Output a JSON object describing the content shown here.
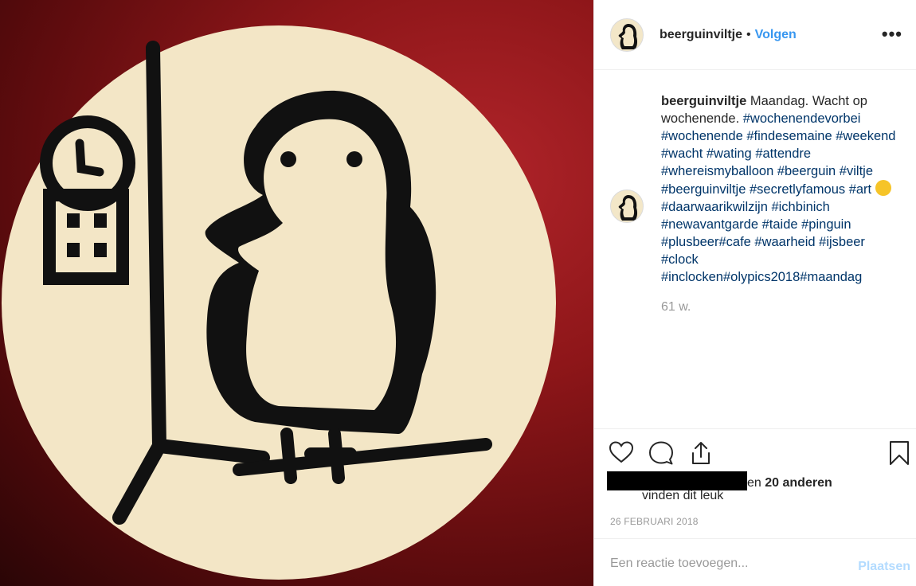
{
  "post": {
    "username": "beerguinviltje",
    "separator": "•",
    "follow_label": "Volgen",
    "more_label": "•••"
  },
  "caption": {
    "username": "beerguinviltje",
    "text": " Maandag. Wacht op wochenende. ",
    "tags_part1": "#wochenendevorbei #wochenende #findesemaine #weekend #wacht #wating #attendre #whereismyballoon #beerguin #viltje #beerguinviltje #secretlyfamous #art",
    "emoji_name": "artist-palette-emoji",
    "tags_part2": " #daarwaarikwilzijn #ichbinich #newavantgarde #taide #pinguin #plusbeer#cafe #waarheid #ijsbeer #clock #inclocken#olypics2018#maandag",
    "time_ago": "61 w."
  },
  "likes": {
    "suffix": "en ",
    "count_text": "20 anderen",
    "second_line": "vinden dit leuk"
  },
  "date": "26 FEBRUARI 2018",
  "comment": {
    "placeholder": "Een reactie toevoegen...",
    "post_label": "Plaatsen"
  },
  "icons": [
    "heart-icon",
    "comment-icon",
    "share-icon",
    "bookmark-icon",
    "more-icon"
  ],
  "colors": {
    "link": "#3897f0",
    "hashtag": "#003569",
    "muted": "#999999",
    "post_disabled": "#b3dbff"
  }
}
